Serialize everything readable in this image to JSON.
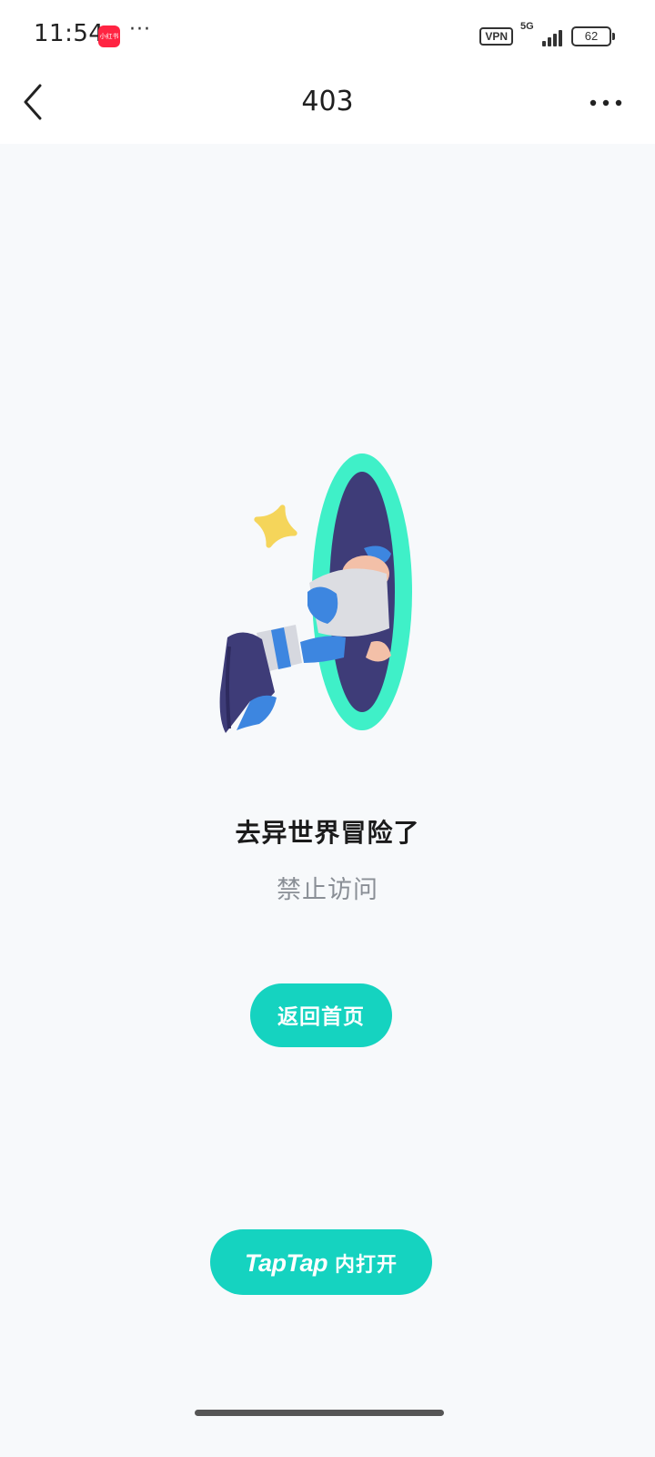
{
  "status_bar": {
    "time": "11:54",
    "app_badge_text": "小红书",
    "more": "···",
    "vpn": "VPN",
    "network": "5G",
    "battery": "62"
  },
  "nav": {
    "title": "403",
    "back_icon": "chevron-left-icon",
    "more_icon": "more-horizontal-icon"
  },
  "error": {
    "illustration": "portal-legs-illustration",
    "title": "去异世界冒险了",
    "subtitle": "禁止访问"
  },
  "buttons": {
    "home_label": "返回首页",
    "open_app_brand": "TapTap",
    "open_app_label": "内打开"
  },
  "colors": {
    "accent": "#15d3c0",
    "portal": "#3ff0c8",
    "portal_inner": "#3e3c78",
    "star": "#f5d55a",
    "background": "#f7f9fb"
  }
}
